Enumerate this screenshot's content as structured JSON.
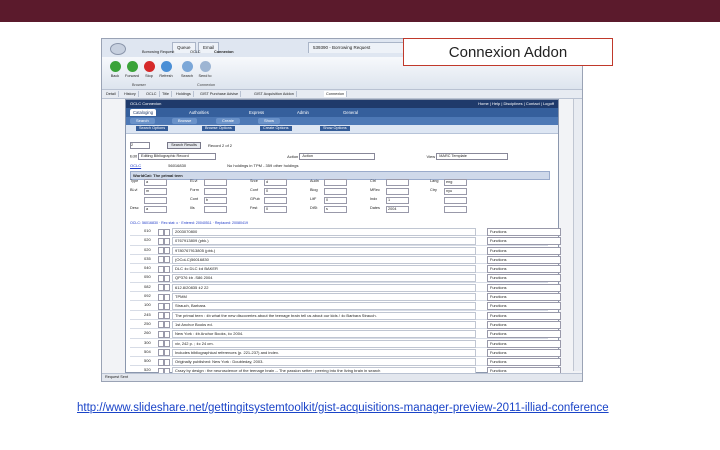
{
  "slide": {
    "callout": "Connexion Addon",
    "caption": "http://www.slideshare.net/gettingitsystemtoolkit/gist-acquisitions-manager-preview-2011-illiad-conference"
  },
  "browser": {
    "tabs": [
      {
        "label": "Queue"
      },
      {
        "label": "Email"
      },
      {
        "label": "539390 - Borrowing Request"
      }
    ],
    "ribbon_tabs": [
      {
        "label": "Borrowing Request"
      },
      {
        "label": "OCLC"
      },
      {
        "label": "Connexion"
      }
    ],
    "buttons": [
      {
        "label": "Back",
        "icon": "back-arrow-icon"
      },
      {
        "label": "Forward",
        "icon": "forward-arrow-icon"
      },
      {
        "label": "Stop",
        "icon": "stop-icon"
      },
      {
        "label": "Refresh",
        "icon": "refresh-icon"
      },
      {
        "label": "Search",
        "icon": "search-icon"
      },
      {
        "label": "Send to",
        "icon": "send-icon"
      }
    ],
    "section_labels": {
      "browser": "Browser",
      "connexion": "Connexion"
    },
    "nav_tabs": [
      {
        "label": "Detail"
      },
      {
        "label": "History"
      },
      {
        "label": "OCLC"
      },
      {
        "label": "Title"
      },
      {
        "label": "Holdings"
      },
      {
        "label": "GIST Purchase Advise"
      },
      {
        "label": "GIST Acquisition Addon"
      },
      {
        "label": "Connexion"
      }
    ],
    "status": "Request Sent"
  },
  "app": {
    "header": "OCLC Connexion",
    "header_links": "Home | Help | Disciplines | Contact | Logoff",
    "menu": [
      {
        "label": "Cataloging",
        "active": true
      },
      {
        "label": "Authorities",
        "active": false
      },
      {
        "label": "Express",
        "active": false
      },
      {
        "label": "Admin",
        "active": false
      },
      {
        "label": "General",
        "active": false
      }
    ],
    "submenu": [
      {
        "label": "Search"
      },
      {
        "label": "Browse"
      },
      {
        "label": "Create"
      },
      {
        "label": "Show"
      }
    ],
    "options": [
      {
        "label": "Search Options"
      },
      {
        "label": "Browse Options"
      },
      {
        "label": "Create Options"
      },
      {
        "label": "Show Options"
      }
    ],
    "search_value": "2",
    "search_results_btn": "Search Results",
    "record_of": "Record 2 of 2",
    "edit_label": "Edit",
    "edit_select": "Editing Bibliographic Record",
    "action_label": "Action",
    "action_select": "Action",
    "view_label": "View",
    "view_select": "MARC Template",
    "oclc_label": "OCLC",
    "oclc_number": "56016830",
    "holdings_note": "No holdings in TPM - 359 other holdings",
    "record_header": "WorldCat: The primal teen",
    "fixed_fields": [
      [
        "Type",
        "a",
        "ELvl",
        "",
        "Srce",
        "d",
        "Audn",
        "",
        "Ctrl",
        "",
        "Lang",
        "eng"
      ],
      [
        "BLvl",
        "m",
        "Form",
        "",
        "Conf",
        "0",
        "Biog",
        "",
        "MRec",
        "",
        "Ctry",
        "nyu"
      ],
      [
        "",
        "",
        "Cont",
        "b",
        "GPub",
        "",
        "LitF",
        "0",
        "Indx",
        "1",
        "",
        ""
      ],
      [
        "Desc",
        "a",
        "Ills",
        "",
        "Fest",
        "0",
        "DtSt",
        "s",
        "Dates",
        "2004",
        "",
        ""
      ]
    ],
    "field_rows": [
      {
        "tag": "010",
        "value": "2003070800"
      },
      {
        "tag": "020",
        "value": "0767913809 (pbk.)"
      },
      {
        "tag": "020",
        "value": "9780767913805 (pbk.)"
      },
      {
        "tag": "035",
        "value": "(OCoLC)56016830"
      },
      {
        "tag": "040",
        "value": "DLC ǂc DLC ǂd BAKER"
      },
      {
        "tag": "050",
        "value": "QP376 ǂb .S86 2004"
      },
      {
        "tag": "082",
        "value": "612.8/20835 ǂ2 22"
      },
      {
        "tag": "092",
        "value": "TPMM"
      },
      {
        "tag": "100",
        "value": "Strauch, Barbara."
      },
      {
        "tag": "245",
        "value": "The primal teen : ǂb what the new discoveries about the teenage brain tell us about our kids / ǂc Barbara Strauch."
      },
      {
        "tag": "250",
        "value": "1st Anchor Books ed."
      },
      {
        "tag": "260",
        "value": "New York : ǂb Anchor Books, ǂc 2004."
      },
      {
        "tag": "300",
        "value": "xiv, 242 p. ; ǂc 24 cm."
      },
      {
        "tag": "504",
        "value": "Includes bibliographical references (p. 221-237) and index."
      },
      {
        "tag": "500",
        "value": "Originally published: New York : Doubleday, 2003."
      },
      {
        "tag": "520",
        "value": "Crazy by design : the neuroscience of the teenage brain -- The passion setter : peering into the living brain in search"
      }
    ],
    "function_label": "Functions"
  }
}
